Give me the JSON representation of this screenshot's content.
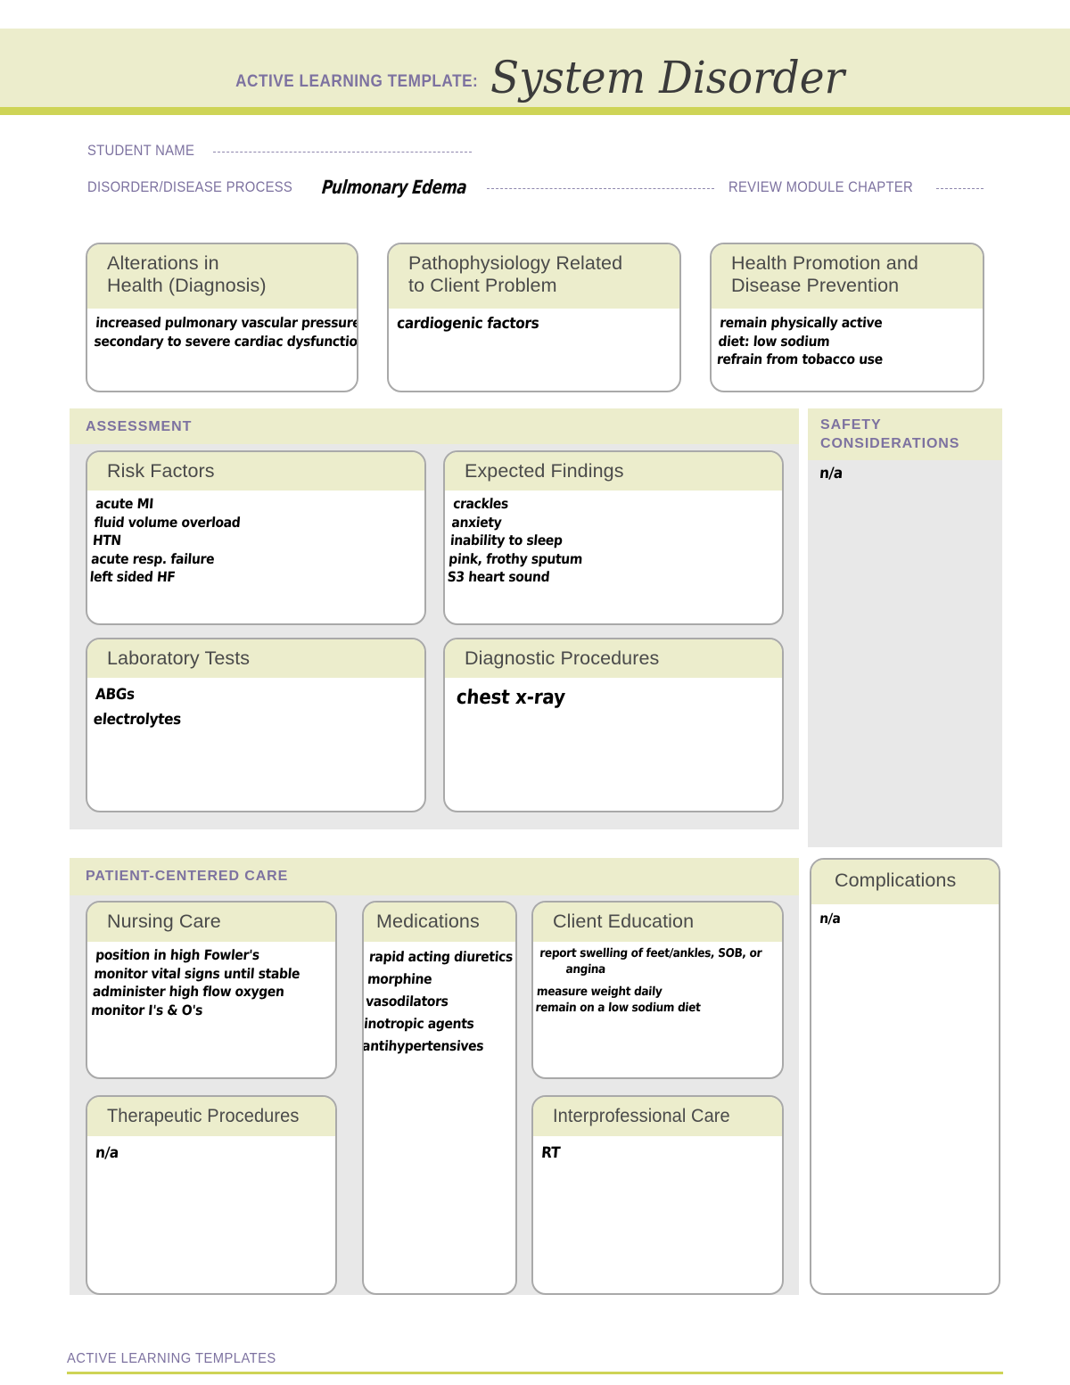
{
  "header": {
    "eyebrow": "ACTIVE LEARNING TEMPLATE:",
    "title": "System Disorder",
    "band_color": "#ecedcc",
    "stripe_color": "#ced456",
    "accent_color": "#7d72a0"
  },
  "form": {
    "student_name_label": "STUDENT NAME",
    "disorder_label": "DISORDER/DISEASE PROCESS",
    "disorder_value": "Pulmonary Edema",
    "review_chapter_label": "REVIEW MODULE CHAPTER"
  },
  "top_boxes": [
    {
      "title_line1": "Alterations in",
      "title_line2": "Health (Diagnosis)",
      "lines": [
        "increased pulmonary vascular pressure",
        "secondary to severe cardiac dysfunction"
      ]
    },
    {
      "title_line1": "Pathophysiology Related",
      "title_line2": "to Client Problem",
      "lines": [
        "cardiogenic factors"
      ]
    },
    {
      "title_line1": "Health Promotion and",
      "title_line2": "Disease Prevention",
      "lines": [
        "remain physically active",
        "diet: low sodium",
        "refrain from tobacco use"
      ]
    }
  ],
  "assessment": {
    "panel_title": "ASSESSMENT",
    "risk_factors": {
      "title": "Risk Factors",
      "lines": [
        "acute MI",
        "fluid volume overload",
        "HTN",
        "acute resp. failure",
        "left sided HF"
      ]
    },
    "expected_findings": {
      "title": "Expected Findings",
      "lines": [
        "crackles",
        "anxiety",
        "inability to sleep",
        "pink, frothy sputum",
        "S3 heart sound"
      ]
    },
    "laboratory_tests": {
      "title": "Laboratory Tests",
      "lines": [
        "ABGs",
        "electrolytes"
      ]
    },
    "diagnostic_procedures": {
      "title": "Diagnostic Procedures",
      "lines": [
        "chest x-ray"
      ]
    }
  },
  "safety": {
    "title_line1": "SAFETY",
    "title_line2": "CONSIDERATIONS",
    "lines": [
      "n/a"
    ]
  },
  "patient_care": {
    "panel_title": "PATIENT-CENTERED CARE",
    "nursing_care": {
      "title": "Nursing Care",
      "lines": [
        "position in high Fowler's",
        "monitor vital signs until stable",
        "administer high flow oxygen",
        "monitor I's & O's"
      ]
    },
    "medications": {
      "title": "Medications",
      "lines": [
        "rapid acting diuretics",
        "morphine",
        "vasodilators",
        "inotropic agents",
        "antihypertensives"
      ]
    },
    "client_education": {
      "title": "Client Education",
      "lines": [
        "report swelling of feet/ankles, SOB, or",
        "angina",
        "measure weight daily",
        "remain on a low sodium diet"
      ]
    },
    "therapeutic_procedures": {
      "title": "Therapeutic Procedures",
      "lines": [
        "n/a"
      ]
    },
    "interprofessional_care": {
      "title": "Interprofessional Care",
      "lines": [
        "RT"
      ]
    }
  },
  "complications": {
    "title": "Complications",
    "lines": [
      "n/a"
    ]
  },
  "footer": {
    "text": "ACTIVE LEARNING TEMPLATES"
  }
}
